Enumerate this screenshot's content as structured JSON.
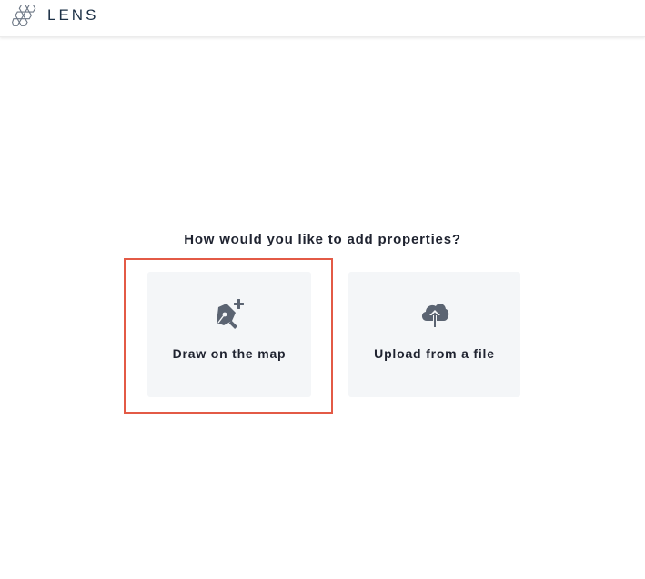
{
  "header": {
    "logo_text": "LENS",
    "logo_icon": "hexagon-cluster-icon"
  },
  "main": {
    "question": "How would you like to add properties?",
    "options": [
      {
        "label": "Draw on the map",
        "icon": "pen-tool-plus-icon",
        "highlighted": true
      },
      {
        "label": "Upload from a file",
        "icon": "cloud-upload-icon",
        "highlighted": false
      }
    ]
  },
  "colors": {
    "highlight_border": "#e35a46",
    "card_background": "#f4f6f8",
    "icon_color": "#5b6472",
    "brand_text": "#1b2f45"
  }
}
